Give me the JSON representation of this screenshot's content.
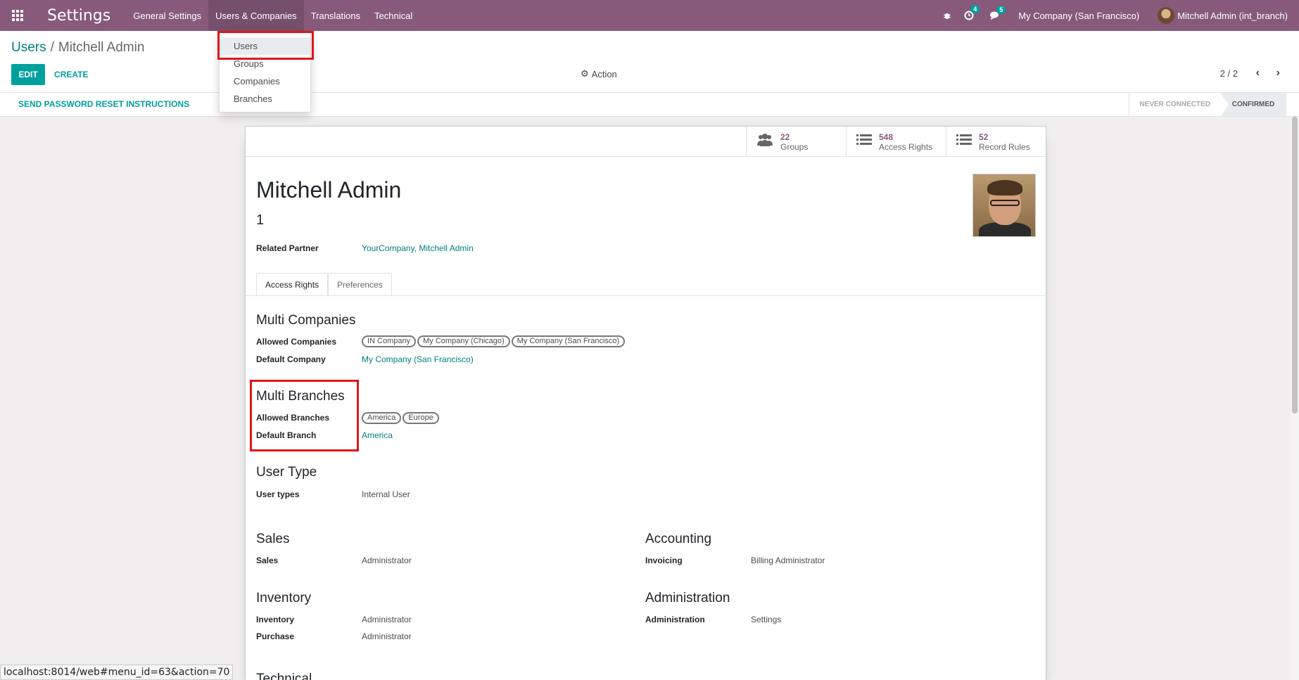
{
  "navbar": {
    "app_title": "Settings",
    "menu": [
      "General Settings",
      "Users & Companies",
      "Translations",
      "Technical"
    ],
    "activity_count": "4",
    "message_count": "5",
    "company": "My Company (San Francisco)",
    "user": "Mitchell Admin (int_branch)"
  },
  "dropdown": {
    "items": [
      "Users",
      "Groups",
      "Companies",
      "Branches"
    ]
  },
  "control": {
    "breadcrumb_parent": "Users",
    "breadcrumb_current": "Mitchell Admin",
    "edit_label": "EDIT",
    "create_label": "CREATE",
    "action_label": "Action",
    "pager": "2 / 2"
  },
  "statusbar": {
    "reset_label": "SEND PASSWORD RESET INSTRUCTIONS",
    "stage_never": "NEVER CONNECTED",
    "stage_confirmed": "CONFIRMED"
  },
  "stats": [
    {
      "value": "22",
      "label": "Groups",
      "icon": "users-icon"
    },
    {
      "value": "548",
      "label": "Access Rights",
      "icon": "list-icon"
    },
    {
      "value": "52",
      "label": "Record Rules",
      "icon": "list-icon"
    }
  ],
  "record": {
    "name": "Mitchell Admin",
    "login": "1",
    "related_partner_label": "Related Partner",
    "related_partner": "YourCompany, Mitchell Admin"
  },
  "tabs": [
    "Access Rights",
    "Preferences"
  ],
  "multi_companies": {
    "title": "Multi Companies",
    "allowed_label": "Allowed Companies",
    "allowed": [
      "IN Company",
      "My Company (Chicago)",
      "My Company (San Francisco)"
    ],
    "default_label": "Default Company",
    "default": "My Company (San Francisco)"
  },
  "multi_branches": {
    "title": "Multi Branches",
    "allowed_label": "Allowed Branches",
    "allowed": [
      "America",
      "Europe"
    ],
    "default_label": "Default Branch",
    "default": "America"
  },
  "user_type": {
    "title": "User Type",
    "label": "User types",
    "value": "Internal User"
  },
  "sales": {
    "title": "Sales",
    "label": "Sales",
    "value": "Administrator"
  },
  "accounting": {
    "title": "Accounting",
    "label": "Invoicing",
    "value": "Billing Administrator"
  },
  "inventory": {
    "title": "Inventory",
    "rows": [
      {
        "label": "Inventory",
        "value": "Administrator"
      },
      {
        "label": "Purchase",
        "value": "Administrator"
      }
    ]
  },
  "administration": {
    "title": "Administration",
    "label": "Administration",
    "value": "Settings"
  },
  "technical_title": "Technical",
  "status_url": "localhost:8014/web#menu_id=63&action=70",
  "colors": {
    "brand": "#875a7b",
    "accent": "#00a09d",
    "link": "#017e84",
    "highlight": "#e0161b"
  }
}
